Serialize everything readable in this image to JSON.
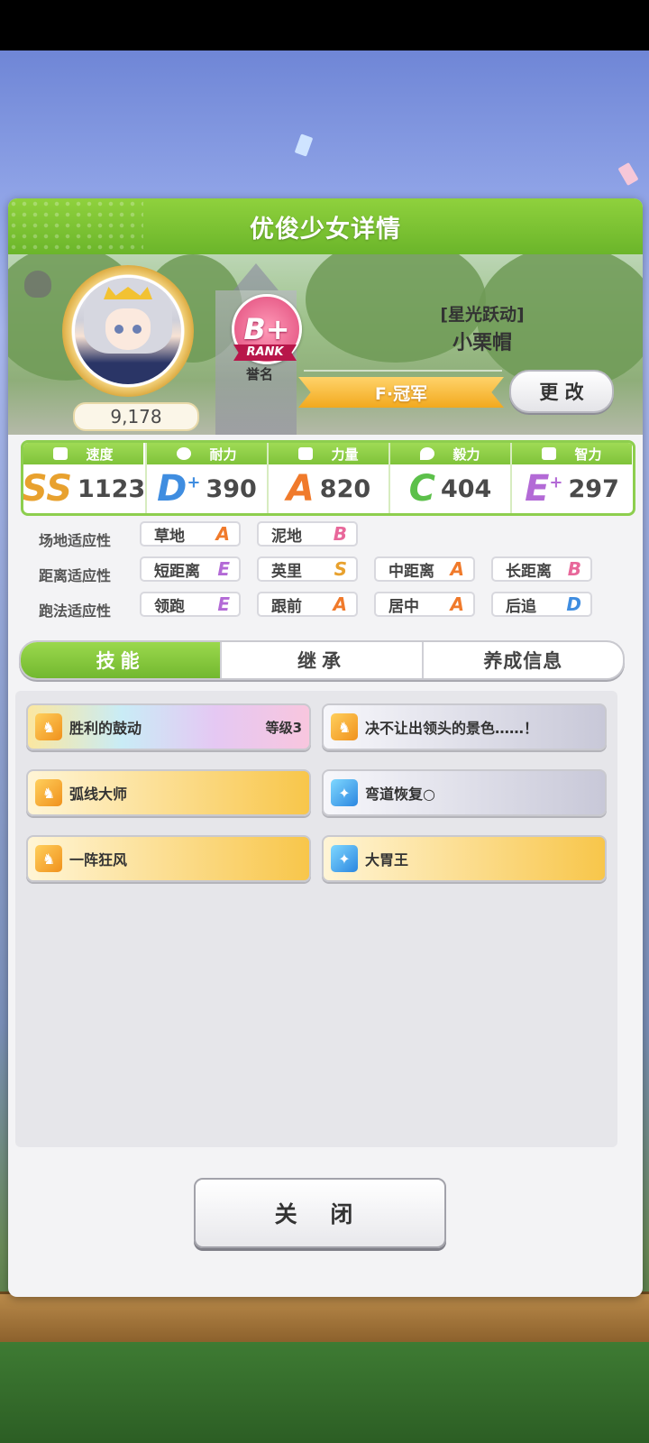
{
  "dialog": {
    "title": "优俊少女详情"
  },
  "profile": {
    "power": "9,178",
    "rank_grade": "B+",
    "rank_word": "RANK",
    "rank_label": "誉名",
    "epithet": "[星光跃动]",
    "name": "小栗帽",
    "title_ribbon": "F·冠军",
    "change_button": "更 改"
  },
  "stats": [
    {
      "label": "速度",
      "grade": "SS",
      "value": "1123",
      "color": "#e8a12e"
    },
    {
      "label": "耐力",
      "grade": "D",
      "grade_suffix": "+",
      "value": "390",
      "color": "#3f8de0"
    },
    {
      "label": "力量",
      "grade": "A",
      "value": "820",
      "color": "#f07a2b"
    },
    {
      "label": "毅力",
      "grade": "C",
      "value": "404",
      "color": "#5cc04a"
    },
    {
      "label": "智力",
      "grade": "E",
      "grade_suffix": "+",
      "value": "297",
      "color": "#b36ad6"
    }
  ],
  "aptitude": {
    "field_label": "场地适应性",
    "distance_label": "距离适应性",
    "style_label": "跑法适应性",
    "field": [
      {
        "name": "草地",
        "grade": "A"
      },
      {
        "name": "泥地",
        "grade": "B"
      }
    ],
    "distance": [
      {
        "name": "短距离",
        "grade": "E"
      },
      {
        "name": "英里",
        "grade": "S"
      },
      {
        "name": "中距离",
        "grade": "A"
      },
      {
        "name": "长距离",
        "grade": "B"
      }
    ],
    "style": [
      {
        "name": "领跑",
        "grade": "E"
      },
      {
        "name": "跟前",
        "grade": "A"
      },
      {
        "name": "居中",
        "grade": "A"
      },
      {
        "name": "后追",
        "grade": "D"
      }
    ]
  },
  "grade_colors": {
    "A": "#f07a2b",
    "B": "#e8679a",
    "S": "#e8a12e",
    "E": "#b36ad6",
    "D": "#3f8de0"
  },
  "tabs": [
    {
      "label": "技能",
      "active": true
    },
    {
      "label": "继承",
      "active": false
    },
    {
      "label": "养成信息",
      "active": false
    }
  ],
  "skills": [
    {
      "name": "胜利的鼓动",
      "level": "等级3",
      "style": "rainbow",
      "icon": "gold-horse-icon"
    },
    {
      "name": "决不让出领头的景色……！",
      "level": "",
      "style": "silver",
      "icon": "gold-horse-icon"
    },
    {
      "name": "弧线大师",
      "level": "",
      "style": "gold",
      "icon": "gold-horse-icon"
    },
    {
      "name": "弯道恢复○",
      "level": "",
      "style": "silver",
      "icon": "blue-sparkle-icon"
    },
    {
      "name": "一阵狂风",
      "level": "",
      "style": "gold",
      "icon": "gold-horse-icon"
    },
    {
      "name": "大胃王",
      "level": "",
      "style": "gold",
      "icon": "blue-sparkle-icon"
    }
  ],
  "close_button": "关 闭"
}
